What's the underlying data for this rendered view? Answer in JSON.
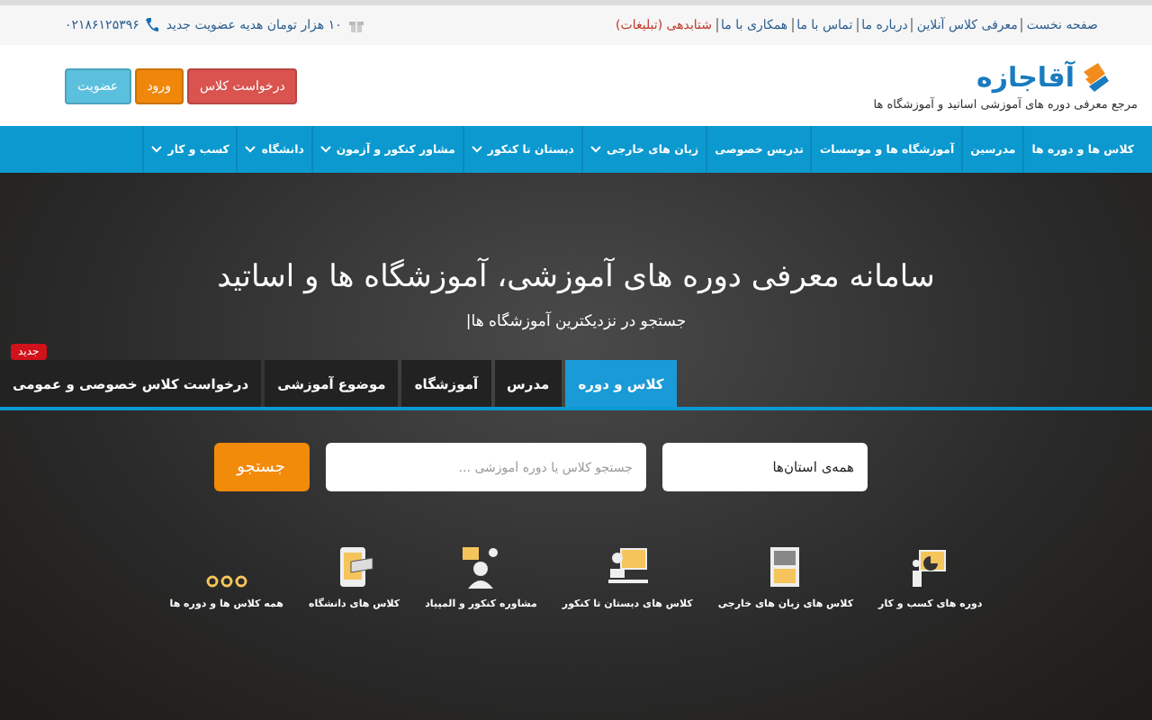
{
  "top_bar": {
    "links": [
      {
        "label": "صفحه نخست",
        "highlight": false
      },
      {
        "label": "معرفی کلاس آنلاین",
        "highlight": false
      },
      {
        "label": "درباره ما",
        "highlight": false
      },
      {
        "label": "تماس با ما",
        "highlight": false
      },
      {
        "label": "همکاری با ما",
        "highlight": false
      },
      {
        "label": "شتابدهی (تبلیغات)",
        "highlight": true
      }
    ],
    "promo": "۱۰ هزار تومان هدیه عضویت جدید",
    "phone": "۰۲۱۸۶۱۲۵۳۹۶"
  },
  "header": {
    "logo": "آقاجازه",
    "tagline": "مرجع معرفی دوره های آموزشی اساتید و آموزشگاه ها",
    "buttons": [
      {
        "label": "درخواست کلاس",
        "kind": "danger"
      },
      {
        "label": "ورود",
        "kind": "warning"
      },
      {
        "label": "عضویت",
        "kind": "info"
      }
    ]
  },
  "nav": [
    {
      "label": "کلاس ها و دوره ها",
      "dropdown": false
    },
    {
      "label": "مدرسین",
      "dropdown": false
    },
    {
      "label": "آموزشگاه ها و موسسات",
      "dropdown": false
    },
    {
      "label": "تدریس خصوصی",
      "dropdown": false
    },
    {
      "label": "زبان های خارجی",
      "dropdown": true
    },
    {
      "label": "دبستان تا کنکور",
      "dropdown": true
    },
    {
      "label": "مشاور کنکور و آزمون",
      "dropdown": true
    },
    {
      "label": "دانشگاه",
      "dropdown": true
    },
    {
      "label": "کسب و کار",
      "dropdown": true
    }
  ],
  "hero": {
    "title": "سامانه معرفی دوره های آموزشی، آموزشگاه ها و اساتید",
    "subtitle": "جستجو در نزدیکترین آموزشگاه ها|",
    "tabs": [
      {
        "label": "کلاس و دوره",
        "selected": true
      },
      {
        "label": "مدرس",
        "selected": false
      },
      {
        "label": "آموزشگاه",
        "selected": false
      },
      {
        "label": "موضوع آموزشی",
        "selected": false
      },
      {
        "label": "درخواست کلاس خصوصی و عمومی",
        "selected": false,
        "badge": "جدید"
      }
    ],
    "search": {
      "province": "همه‌ی استان‌ها",
      "placeholder": "جستجو کلاس یا دوره آموزشی ...",
      "button": "جستجو"
    },
    "categories": [
      {
        "label": "دوره های کسب و کار"
      },
      {
        "label": "کلاس های زبان های خارجی"
      },
      {
        "label": "کلاس های دبستان تا کنکور"
      },
      {
        "label": "مشاوره کنکور و المپیاد"
      },
      {
        "label": "کلاس های دانشگاه"
      },
      {
        "label": "همه کلاس ها و دوره ها"
      }
    ]
  }
}
